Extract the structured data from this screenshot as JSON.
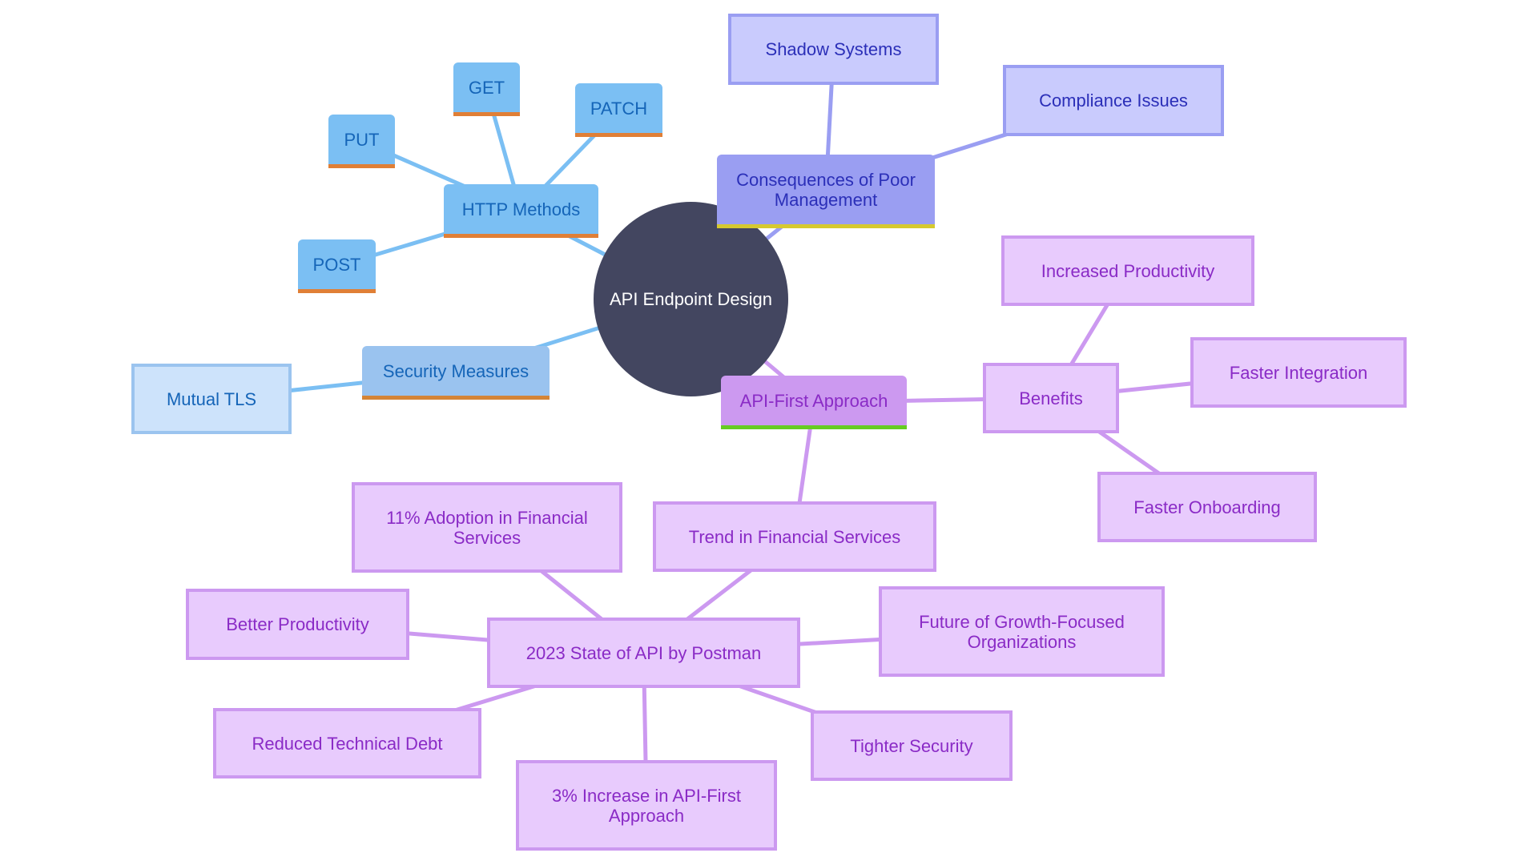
{
  "diagram": {
    "type": "mindmap",
    "root": {
      "id": "root",
      "label": "API Endpoint Design"
    },
    "nodes": [
      {
        "id": "http",
        "label": "HTTP Methods",
        "parent": "root",
        "branch": "blue"
      },
      {
        "id": "post",
        "label": "POST",
        "parent": "http",
        "branch": "blue"
      },
      {
        "id": "put",
        "label": "PUT",
        "parent": "http",
        "branch": "blue"
      },
      {
        "id": "get",
        "label": "GET",
        "parent": "http",
        "branch": "blue"
      },
      {
        "id": "patch",
        "label": "PATCH",
        "parent": "http",
        "branch": "blue"
      },
      {
        "id": "security",
        "label": "Security Measures",
        "parent": "root",
        "branch": "blue"
      },
      {
        "id": "mtls",
        "label": "Mutual TLS",
        "parent": "security",
        "branch": "blue"
      },
      {
        "id": "consequences",
        "label": "Consequences of Poor Management",
        "parent": "root",
        "branch": "indigo"
      },
      {
        "id": "shadow",
        "label": "Shadow Systems",
        "parent": "consequences",
        "branch": "indigo"
      },
      {
        "id": "compliance",
        "label": "Compliance Issues",
        "parent": "consequences",
        "branch": "indigo"
      },
      {
        "id": "apifirst",
        "label": "API-First Approach",
        "parent": "root",
        "branch": "purple"
      },
      {
        "id": "benefits",
        "label": "Benefits",
        "parent": "apifirst",
        "branch": "purple"
      },
      {
        "id": "incprod",
        "label": "Increased Productivity",
        "parent": "benefits",
        "branch": "purple"
      },
      {
        "id": "fastint",
        "label": "Faster Integration",
        "parent": "benefits",
        "branch": "purple"
      },
      {
        "id": "fastonb",
        "label": "Faster Onboarding",
        "parent": "benefits",
        "branch": "purple"
      },
      {
        "id": "trend",
        "label": "Trend in Financial Services",
        "parent": "apifirst",
        "branch": "purple"
      },
      {
        "id": "postman",
        "label": "2023 State of API by Postman",
        "parent": "trend",
        "branch": "purple"
      },
      {
        "id": "adoption",
        "label": "11% Adoption in Financial Services",
        "parent": "postman",
        "branch": "purple"
      },
      {
        "id": "betterprod",
        "label": "Better Productivity",
        "parent": "postman",
        "branch": "purple"
      },
      {
        "id": "debt",
        "label": "Reduced Technical Debt",
        "parent": "postman",
        "branch": "purple"
      },
      {
        "id": "increase",
        "label": "3% Increase in API-First Approach",
        "parent": "postman",
        "branch": "purple"
      },
      {
        "id": "tighter",
        "label": "Tighter Security",
        "parent": "postman",
        "branch": "purple"
      },
      {
        "id": "future",
        "label": "Future of Growth-Focused Organizations",
        "parent": "postman",
        "branch": "purple"
      }
    ],
    "colors": {
      "root_fill": "#434660",
      "blue_edge": "#7bbff3",
      "indigo_edge": "#9a9ef2",
      "purple_edge": "#cc99f0",
      "http_underline": "#e07f36",
      "consequences_underline": "#d6c92f",
      "apifirst_underline": "#66cc22"
    }
  }
}
